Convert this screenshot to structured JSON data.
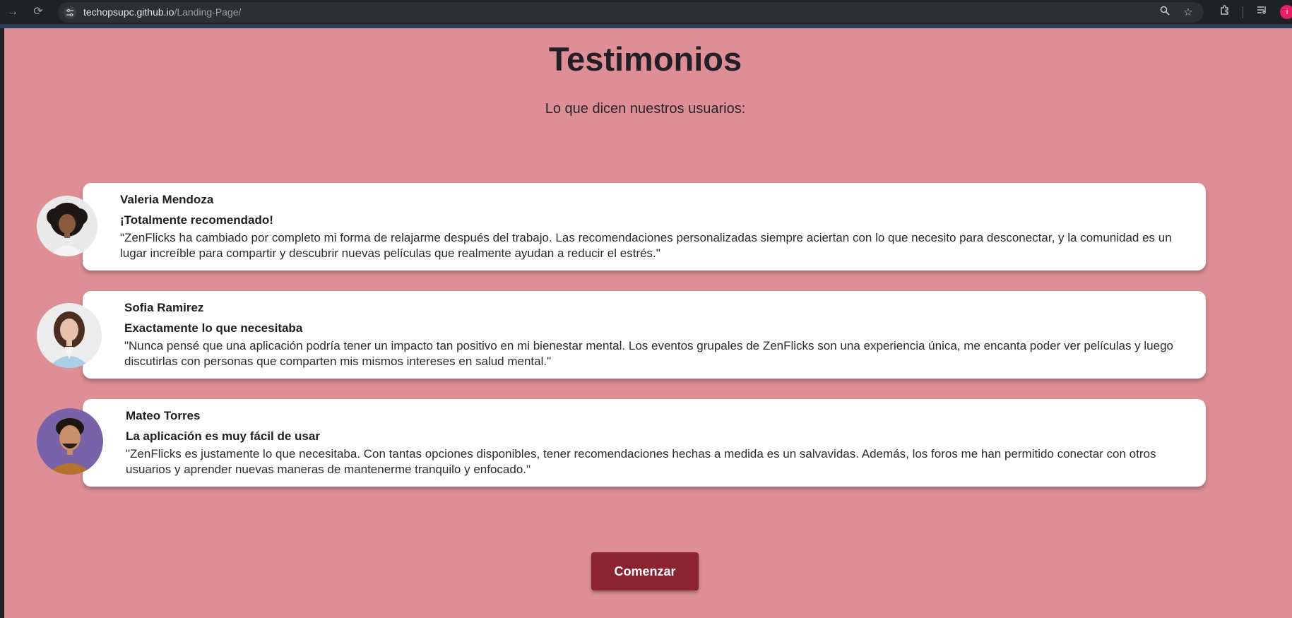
{
  "browser": {
    "url_host": "techopsupc.github.io",
    "url_path": "/Landing-Page/",
    "profile_initial": "i"
  },
  "section": {
    "title": "Testimonios",
    "subtitle": "Lo que dicen nuestros usuarios:"
  },
  "testimonials": [
    {
      "name": "Valeria Mendoza",
      "headline": "¡Totalmente recomendado!",
      "quote": "\"ZenFlicks ha cambiado por completo mi forma de relajarme después del trabajo. Las recomendaciones personalizadas siempre aciertan con lo que necesito para desconectar, y la comunidad es un lugar increíble para compartir y descubrir nuevas películas que realmente ayudan a reducir el estrés.\""
    },
    {
      "name": "Sofia Ramirez",
      "headline": "Exactamente lo que necesitaba",
      "quote": "\"Nunca pensé que una aplicación podría tener un impacto tan positivo en mi bienestar mental. Los eventos grupales de ZenFlicks son una experiencia única, me encanta poder ver películas y luego discutirlas con personas que comparten mis mismos intereses en salud mental.\""
    },
    {
      "name": "Mateo Torres",
      "headline": "La aplicación es muy fácil de usar",
      "quote": "\"ZenFlicks es justamente lo que necesitaba. Con tantas opciones disponibles, tener recomendaciones hechas a medida es un salvavidas. Además, los foros me han permitido conectar con otros usuarios y aprender nuevas maneras de mantenerme tranquilo y enfocado.\""
    }
  ],
  "cta": {
    "label": "Comenzar"
  },
  "colors": {
    "page_background": "#de8e96",
    "card_background": "#ffffff",
    "cta_background": "#8c2332",
    "title_text": "#231f26"
  }
}
